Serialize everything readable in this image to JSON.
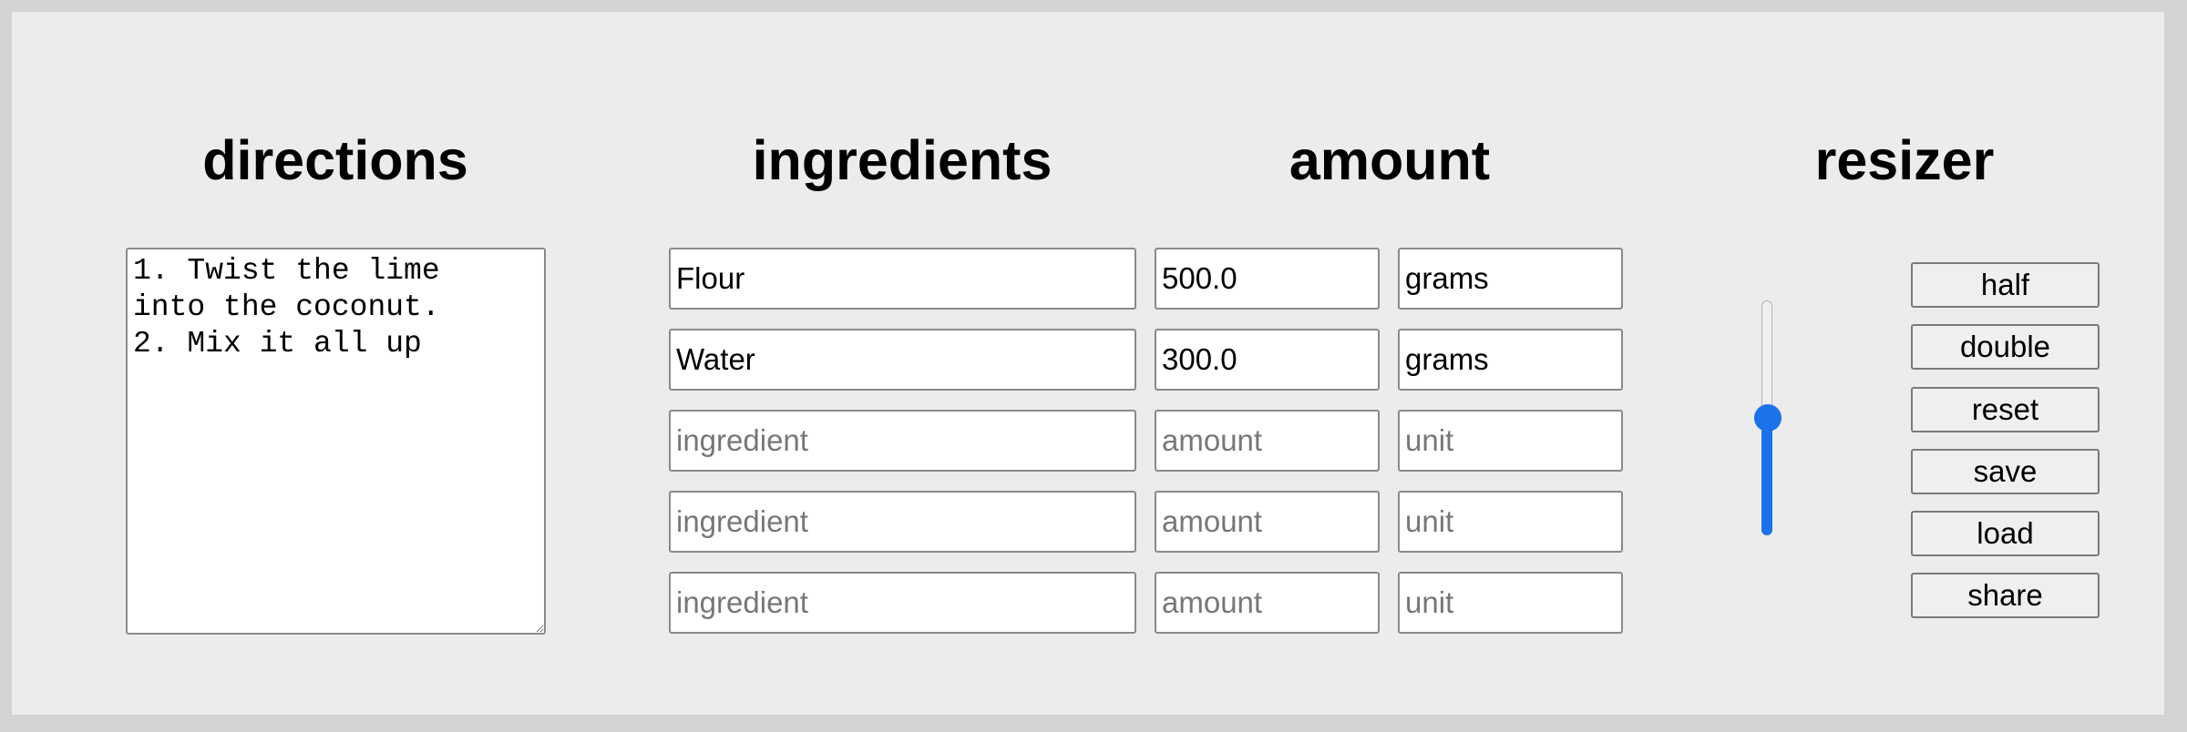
{
  "headings": {
    "directions": "directions",
    "ingredients": "ingredients",
    "amount": "amount",
    "resizer": "resizer"
  },
  "directions": {
    "value": "1. Twist the lime\ninto the coconut.\n2. Mix it all up"
  },
  "rows": [
    {
      "ingredient": "Flour",
      "amount": "500.0",
      "unit": "grams"
    },
    {
      "ingredient": "Water",
      "amount": "300.0",
      "unit": "grams"
    },
    {
      "ingredient": "",
      "amount": "",
      "unit": ""
    },
    {
      "ingredient": "",
      "amount": "",
      "unit": ""
    },
    {
      "ingredient": "",
      "amount": "",
      "unit": ""
    }
  ],
  "placeholders": {
    "ingredient": "ingredient",
    "amount": "amount",
    "unit": "unit"
  },
  "resizer": {
    "orientation": "vertical",
    "value_fraction": 0.5,
    "accent_color": "#1a73e8"
  },
  "buttons": {
    "half": "half",
    "double": "double",
    "reset": "reset",
    "save": "save",
    "load": "load",
    "share": "share"
  }
}
